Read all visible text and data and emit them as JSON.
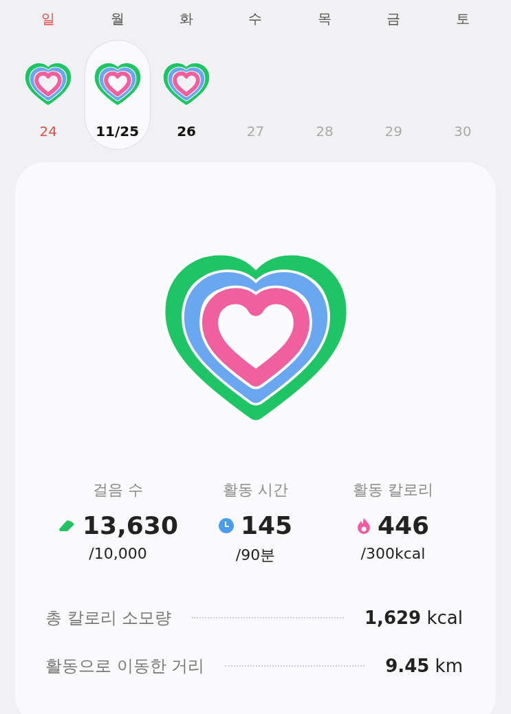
{
  "week": [
    {
      "weekday": "일",
      "date": "24",
      "sunday": true,
      "selected": false,
      "has_ring": true,
      "future": false
    },
    {
      "weekday": "월",
      "date": "11/25",
      "sunday": false,
      "selected": true,
      "has_ring": true,
      "future": false
    },
    {
      "weekday": "화",
      "date": "26",
      "sunday": false,
      "selected": false,
      "has_ring": true,
      "future": false
    },
    {
      "weekday": "수",
      "date": "27",
      "sunday": false,
      "selected": false,
      "has_ring": false,
      "future": true
    },
    {
      "weekday": "목",
      "date": "28",
      "sunday": false,
      "selected": false,
      "has_ring": false,
      "future": true
    },
    {
      "weekday": "금",
      "date": "29",
      "sunday": false,
      "selected": false,
      "has_ring": false,
      "future": true
    },
    {
      "weekday": "토",
      "date": "30",
      "sunday": false,
      "selected": false,
      "has_ring": false,
      "future": true
    }
  ],
  "stats": [
    {
      "kind": "steps",
      "label": "걸음 수",
      "value": "13,630",
      "goal": "/10,000"
    },
    {
      "kind": "time",
      "label": "활동 시간",
      "value": "145",
      "goal": "/90분"
    },
    {
      "kind": "calories",
      "label": "활동 칼로리",
      "value": "446",
      "goal": "/300kcal"
    }
  ],
  "details": [
    {
      "label": "총 칼로리 소모량",
      "value": "1,629",
      "unit": "kcal"
    },
    {
      "label": "활동으로 이동한 거리",
      "value": "9.45",
      "unit": "km"
    }
  ]
}
